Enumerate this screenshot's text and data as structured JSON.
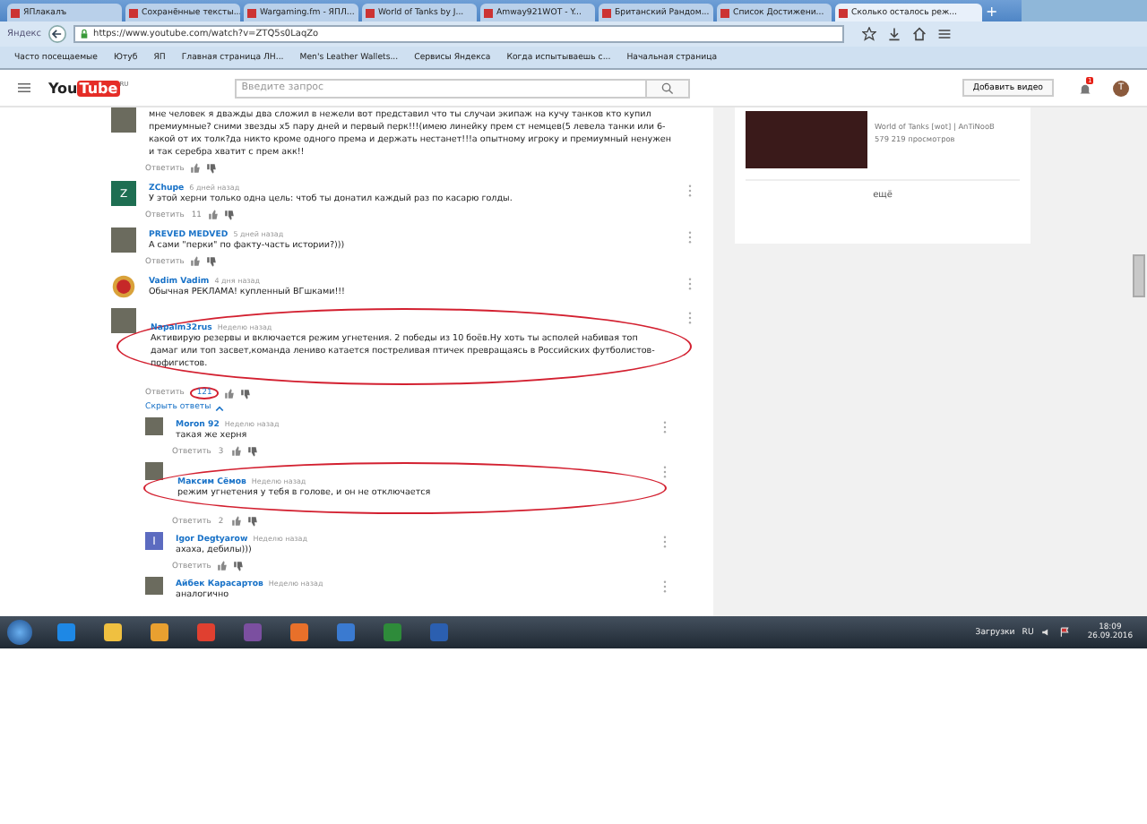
{
  "browser": {
    "tabs": [
      {
        "label": "ЯПлакалъ",
        "selected": false
      },
      {
        "label": "Сохранённые тексты...",
        "selected": false
      },
      {
        "label": "Wargaming.fm - ЯПЛ...",
        "selected": false
      },
      {
        "label": "World of Tanks by J...",
        "selected": false
      },
      {
        "label": "Amway921WOT - Y...",
        "selected": false
      },
      {
        "label": "Британский Рандом...",
        "selected": false
      },
      {
        "label": "Список Достижени...",
        "selected": false
      },
      {
        "label": "Сколько осталось реж...",
        "selected": true
      }
    ],
    "new_tab": "+",
    "search_engine": "Яндекс",
    "address": "https://www.youtube.com/watch?v=ZTQ5s0LaqZo",
    "bookmarks": [
      "Часто посещаемые",
      "Ютуб",
      "ЯП",
      "Главная страница ЛН...",
      "Men's Leather Wallets...",
      "Сервисы Яндекса",
      "Когда испытываешь с...",
      "Начальная страница"
    ]
  },
  "youtube_header": {
    "logo_you": "You",
    "logo_tube": "Tube",
    "logo_region": "RU",
    "search": {
      "placeholder": "Введите запрос"
    },
    "upload_button": "Добавить видео",
    "notification_count": "1",
    "account_letter": "T"
  },
  "comments": [
    {
      "text": "мне человек я дважды два сложил в нежели вот представил что ты случаи экипаж на кучу танков кто купил премиумные? сними звезды х5 пару дней и первый перк!!!(имею линейку прем ст немцев(5 левела танки или 6-какой от их толк?да никто кроме одного према и держать нестанет!!!а опытному игроку и премиумный ненужен и так серебра хватит с прем акк!!",
      "reply_label": "Ответить",
      "circled": false,
      "avatar": {
        "kind": "photo"
      }
    },
    {
      "author": "ZChupe",
      "time": "6 дней назад",
      "text": "У этой херни только одна цель: чтоб ты донатил каждый раз по касарю голды.",
      "reply_label": "Ответить",
      "likes": "11",
      "circled": false,
      "likes_circled": false,
      "avatar": {
        "kind": "letter",
        "letter": "Z",
        "color": "#1e6e52"
      }
    },
    {
      "author": "PREVED MEDVED",
      "time": "5 дней назад",
      "text": "А сами \"перки\" по факту-часть истории?)))",
      "reply_label": "Ответить",
      "circled": false,
      "avatar": {
        "kind": "photo"
      }
    },
    {
      "author": "Vadim Vadim",
      "time": "4 дня назад",
      "text": "Обычная РЕКЛАМА! купленный ВГшками!!!",
      "circled": false,
      "avatar": {
        "kind": "emblem"
      }
    },
    {
      "author": "Napalm32rus",
      "time": "Неделю назад",
      "text": "Активирую резервы и включается режим угнетения. 2 победы из 10 боёв.Ну хоть ты асполей набивая топ дамаг или топ засвет,команда лениво катается постреливая птичек превращаясь в Российских футболистов-пофигистов.",
      "reply_label": "Ответить",
      "likes": "121",
      "circled": true,
      "likes_circled": true,
      "avatar": {
        "kind": "photo"
      },
      "hide_replies": "Скрыть ответы",
      "replies": [
        {
          "author": "Moron 92",
          "time": "Неделю назад",
          "text": "такая же херня",
          "reply_label": "Ответить",
          "likes": "3",
          "circled": false,
          "likes_circled": false,
          "avatar": {
            "kind": "photo"
          }
        },
        {
          "author": "Максим Сёмов",
          "time": "Неделю назад",
          "text": "режим угнетения у тебя в голове, и он не отключается",
          "reply_label": "Ответить",
          "likes": "2",
          "circled": true,
          "likes_circled": false,
          "avatar": {
            "kind": "photo"
          }
        },
        {
          "author": "Igor Degtyarow",
          "time": "Неделю назад",
          "text": "ахаха, дебилы)))",
          "reply_label": "Ответить",
          "circled": false,
          "avatar": {
            "kind": "letter",
            "letter": "I",
            "color": "#5c6bc0"
          }
        },
        {
          "author": "Айбек Карасартов",
          "time": "Неделю назад",
          "text": "аналогично",
          "circled": false,
          "avatar": {
            "kind": "photo"
          }
        }
      ]
    }
  ],
  "sidebar": {
    "video": {
      "channel": "World of Tanks [wot] | AnTiNooB",
      "views": "579 219 просмотров"
    },
    "more_link": "ещё"
  },
  "taskbar": {
    "downloads": "Загрузки",
    "language": "RU",
    "time": "18:09",
    "date": "26.09.2016"
  }
}
